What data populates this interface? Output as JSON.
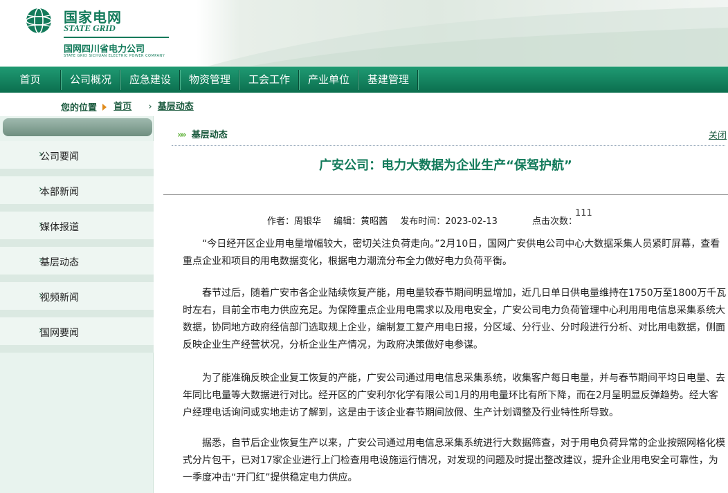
{
  "header": {
    "logo_cn": "国家电网",
    "logo_en": "STATE GRID",
    "company_cn": "国网四川省电力公司",
    "company_en": "STATE GRID SICHUAN ELECTRIC POWER COMPANY",
    "brand_color": "#127a5a"
  },
  "nav": {
    "items": [
      {
        "label": "首页"
      },
      {
        "label": "公司概况"
      },
      {
        "label": "应急建设"
      },
      {
        "label": "物资管理"
      },
      {
        "label": "工会工作"
      },
      {
        "label": "产业单位"
      },
      {
        "label": "基建管理"
      }
    ],
    "color": "#0b6e4e"
  },
  "breadcrumb": {
    "prefix": "您的位置",
    "home": "首页",
    "current": "基层动态"
  },
  "sidebar": {
    "items": [
      {
        "label": "公司要闻"
      },
      {
        "label": "本部新闻"
      },
      {
        "label": "媒体报道"
      },
      {
        "label": "基层动态"
      },
      {
        "label": "视频新闻"
      },
      {
        "label": "国网要闻"
      }
    ]
  },
  "article": {
    "section": "基层动态",
    "close": "关闭",
    "title": "广安公司：电力大数据为企业生产“保驾护航”",
    "author": "作者：周银华",
    "editor": "编辑：黄昭茜",
    "published": "发布时间：2023-02-13",
    "hits_label": "点击次数：",
    "hits": "111",
    "paragraphs": [
      "“今日经开区企业用电量增幅较大，密切关注负荷走向。”2月10日，国网广安供电公司中心大数据采集人员紧盯屏幕，查看重点企业和项目的用电数据变化，根据电力潮流分布全力做好电力负荷平衡。",
      "春节过后，随着广安市各企业陆续恢复产能，用电量较春节期间明显增加，近几日单日供电量维持在1750万至1800万千瓦时左右，目前全市电力供应充足。为保障重点企业用电需求以及用电安全，广安公司电力负荷管理中心利用用电信息采集系统大数据，协同地方政府经信部门选取规上企业，编制复工复产用电日报，分区域、分行业、分时段进行分析、对比用电数据，侧面反映企业生产经营状况，分析企业生产情况，为政府决策做好电参谋。",
      "为了能准确反映企业复工恢复的产能，广安公司通过用电信息采集系统，收集客户每日电量，并与春节期间平均日电量、去年同比电量等大数据进行对比。经开区的广安利尔化学有限公司1月的用电量环比有所下降，而在2月呈明显反弹趋势。经大客户经理电话询问或实地走访了解到，这是由于该企业春节期间放假、生产计划调整及行业特性所导致。",
      "据悉，自节后企业恢复生产以来，广安公司通过用电信息采集系统进行大数据筛查，对于用电负荷异常的企业按照网格化模式分片包干，已对17家企业进行上门检查用电设施运行情况，对发现的问题及时提出整改建议，提升企业用电安全可靠性，为一季度冲击“开门红”提供稳定电力供应。"
    ]
  }
}
